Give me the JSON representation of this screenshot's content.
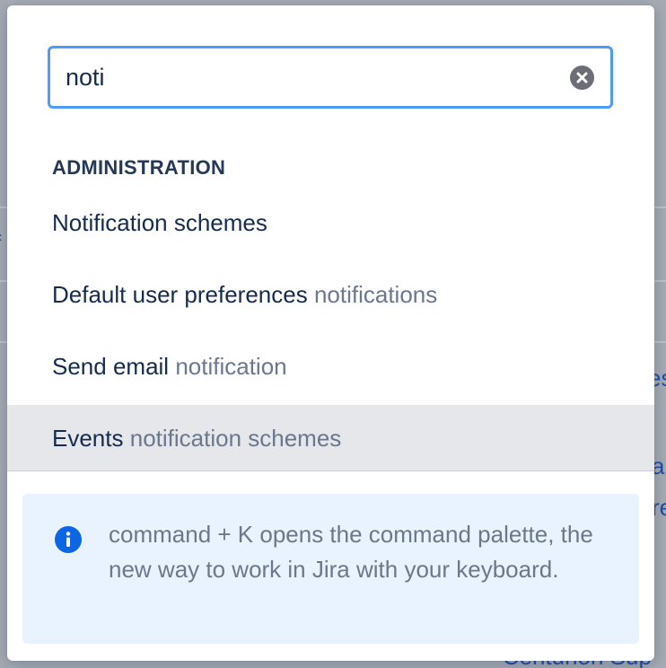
{
  "search": {
    "value": "noti",
    "clear_icon": "close-circle-icon"
  },
  "section": {
    "heading": "ADMINISTRATION"
  },
  "results": [
    {
      "primary": "Notification schemes",
      "secondary": ""
    },
    {
      "primary": "Default user preferences",
      "secondary": "notifications"
    },
    {
      "primary": "Send email",
      "secondary": "notification"
    },
    {
      "primary": "Events",
      "secondary": "notification schemes"
    }
  ],
  "selected_index": 3,
  "info": {
    "icon": "info-icon",
    "text": "command + K opens the command palette, the new way to work in Jira with your keyboard."
  },
  "background": {
    "fragments": [
      "f",
      "es",
      "a",
      "re",
      "Centurion Sup"
    ]
  },
  "colors": {
    "focus_border": "#4c9aff",
    "info_background": "#e9f2ff",
    "info_icon": "#0c66e4",
    "selected_row": "#e5e7ea",
    "text_primary": "#172b4d",
    "text_secondary": "#6b778c"
  }
}
